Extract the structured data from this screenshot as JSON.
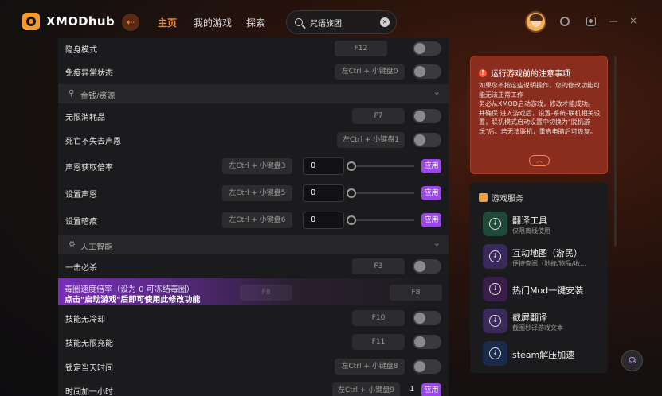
{
  "app": {
    "name": "XMODhub"
  },
  "nav": {
    "back": "⇠",
    "items": [
      {
        "label": "主页"
      },
      {
        "label": "我的游戏"
      },
      {
        "label": "探索"
      }
    ]
  },
  "search": {
    "value": "咒语旅团",
    "clear": "×"
  },
  "window": {
    "minimize": "—",
    "close": "✕"
  },
  "cheats": {
    "rows": [
      {
        "label": "隐身模式",
        "hotkey": "F12"
      },
      {
        "label": "免疫异常状态",
        "hotkey": "左Ctrl + 小键盘0"
      },
      {
        "label": "无限消耗品",
        "hotkey": "F7"
      },
      {
        "label": "死亡不失去声恩",
        "hotkey": "左Ctrl + 小键盘1"
      },
      {
        "label": "声恩获取倍率",
        "hotkey": "左Ctrl + 小键盘3",
        "value": "0",
        "apply": "应用"
      },
      {
        "label": "设置声恩",
        "hotkey": "左Ctrl + 小键盘5",
        "value": "0",
        "apply": "应用"
      },
      {
        "label": "设置暗痕",
        "hotkey": "左Ctrl + 小键盘6",
        "value": "0",
        "apply": "应用"
      },
      {
        "label": "一击必杀",
        "hotkey": "F3"
      },
      {
        "label": "技能无冷却",
        "hotkey": "F10"
      },
      {
        "label": "技能无限充能",
        "hotkey": "F11"
      },
      {
        "label": "锁定当天时间",
        "hotkey": "左Ctrl + 小键盘8"
      },
      {
        "label": "时间加一小时",
        "hotkey": "左Ctrl + 小键盘9",
        "value": "1",
        "apply": "应用"
      }
    ],
    "sections": [
      {
        "title": "金钱/资源"
      },
      {
        "title": "人工智能"
      }
    ],
    "banner": {
      "line1": "毒圈速度倍率（设为 0 可冻结毒圈）",
      "line2": "点击\"启动游戏\"后即可使用此修改功能",
      "ghost_hotkey": "F8",
      "hotkey": "F8"
    }
  },
  "notice": {
    "title": "运行游戏前的注意事项",
    "body": "如果您不按这些说明操作，您的修改功能可能无法正常工作\n务必从XMOD启动游戏，修改才能成功。\n并确保 进入游戏后，设置-系统-联机相关设置，联机模式启动设置中切换为\"脱机游玩\"后。若无法联机，重启电脑后可恢复。",
    "collapse": "︿"
  },
  "services": {
    "title": "游戏服务",
    "items": [
      {
        "name": "翻译工具",
        "desc": "仅限离线使用",
        "color": "#1f4a3a"
      },
      {
        "name": "互动地图（游民）",
        "desc": "便捷查阅（地标/物品/收...",
        "color": "#3a2a5c"
      },
      {
        "name": "热门Mod一键安装",
        "desc": "",
        "color": "#3a1e4a"
      },
      {
        "name": "截屏翻译",
        "desc": "截图秒译游戏文本",
        "color": "#3a2a5c"
      },
      {
        "name": "steam解压加速",
        "desc": "",
        "color": "#1a2a4a"
      }
    ]
  },
  "colors": {
    "accent": "#f28a2e",
    "apply": "#9b46e6",
    "notice_bg": "#8a2c1e"
  }
}
